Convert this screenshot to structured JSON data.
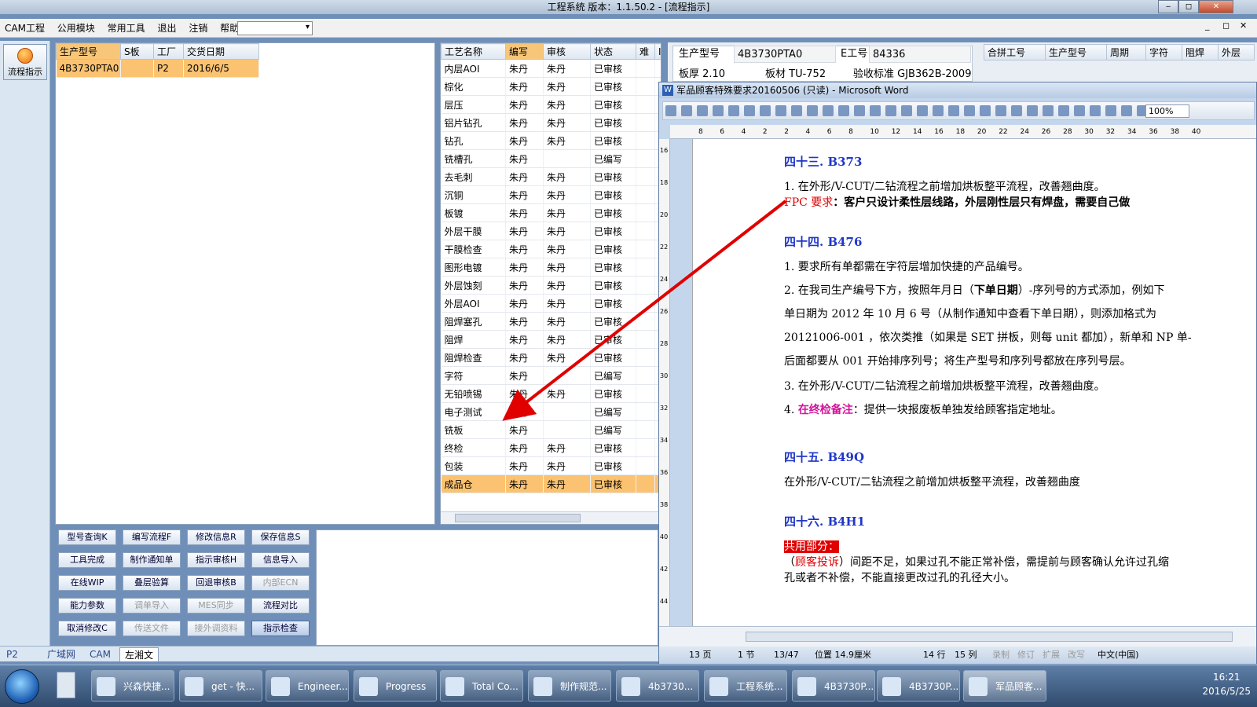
{
  "app": {
    "title": "工程系统   版本：1.1.50.2 - [流程指示]",
    "min": "‒",
    "max": "◻",
    "close": "✕"
  },
  "menu": {
    "items": [
      "CAM工程",
      "公用模块",
      "常用工具",
      "退出",
      "注销",
      "帮助"
    ],
    "help_arrow": "▸",
    "mdi_controls": [
      "_",
      "◻",
      "✕"
    ]
  },
  "left_panel": {
    "flow_button": "流程指示"
  },
  "model_table": {
    "headers": [
      "生产型号",
      "S板",
      "工厂",
      "交货日期"
    ],
    "rows": [
      [
        "4B3730PTA0",
        "",
        "P2",
        "2016/6/5"
      ]
    ]
  },
  "process_table": {
    "headers": [
      "工艺名称",
      "编写",
      "审核",
      "状态",
      "难",
      "I"
    ],
    "rows": [
      [
        "内层AOI",
        "朱丹",
        "朱丹",
        "已审核"
      ],
      [
        "棕化",
        "朱丹",
        "朱丹",
        "已审核"
      ],
      [
        "层压",
        "朱丹",
        "朱丹",
        "已审核"
      ],
      [
        "铝片钻孔",
        "朱丹",
        "朱丹",
        "已审核"
      ],
      [
        "钻孔",
        "朱丹",
        "朱丹",
        "已审核"
      ],
      [
        "铣槽孔",
        "朱丹",
        "",
        "已编写"
      ],
      [
        "去毛刺",
        "朱丹",
        "朱丹",
        "已审核"
      ],
      [
        "沉铜",
        "朱丹",
        "朱丹",
        "已审核"
      ],
      [
        "板镀",
        "朱丹",
        "朱丹",
        "已审核"
      ],
      [
        "外层干膜",
        "朱丹",
        "朱丹",
        "已审核"
      ],
      [
        "干膜检查",
        "朱丹",
        "朱丹",
        "已审核"
      ],
      [
        "图形电镀",
        "朱丹",
        "朱丹",
        "已审核"
      ],
      [
        "外层蚀刻",
        "朱丹",
        "朱丹",
        "已审核"
      ],
      [
        "外层AOI",
        "朱丹",
        "朱丹",
        "已审核"
      ],
      [
        "阻焊塞孔",
        "朱丹",
        "朱丹",
        "已审核"
      ],
      [
        "阻焊",
        "朱丹",
        "朱丹",
        "已审核"
      ],
      [
        "阻焊检查",
        "朱丹",
        "朱丹",
        "已审核"
      ],
      [
        "字符",
        "朱丹",
        "",
        "已编写"
      ],
      [
        "无铅喷锡",
        "朱丹",
        "朱丹",
        "已审核"
      ],
      [
        "电子测试",
        "朱丹",
        "",
        "已编写"
      ],
      [
        "铣板",
        "朱丹",
        "",
        "已编写"
      ],
      [
        "终检",
        "朱丹",
        "朱丹",
        "已审核"
      ],
      [
        "包装",
        "朱丹",
        "朱丹",
        "已审核"
      ],
      [
        "成品仓",
        "朱丹",
        "朱丹",
        "已审核"
      ]
    ],
    "selected_index": 23
  },
  "buttons": [
    [
      "型号查询K",
      "编写流程F",
      "修改信息R",
      "保存信息S"
    ],
    [
      "工具完成",
      "制作通知单",
      "指示审核H",
      "信息导入"
    ],
    [
      "在线WIP",
      "叠层验算",
      "回退审核B",
      "内部ECN"
    ],
    [
      "能力参数",
      "调单导入",
      "MES同步",
      "流程对比"
    ],
    [
      "取消修改C",
      "传送文件",
      "接外调资料",
      "指示检查"
    ]
  ],
  "info": {
    "model_label": "生产型号",
    "model_value": "4B3730PTA0",
    "e_label": "E工号",
    "e_value": "84336",
    "row2_a": "板厚  2.10",
    "row2_b": "板材  TU-752",
    "row2_c": "验收标准  GJB362B-2009"
  },
  "merge_table": {
    "headers": [
      "合拼工号",
      "生产型号",
      "周期",
      "字符",
      "阻焊",
      "外层"
    ]
  },
  "word": {
    "title": "军品顾客特殊要求20160506 (只读) - Microsoft Word",
    "zoom": "100%",
    "ruler": [
      "8",
      "6",
      "4",
      "2",
      "2",
      "4",
      "6",
      "8",
      "10",
      "12",
      "14",
      "16",
      "18",
      "20",
      "22",
      "24",
      "26",
      "28",
      "30",
      "32",
      "34",
      "36",
      "38",
      "40"
    ],
    "vruler": [
      "16",
      "18",
      "20",
      "22",
      "24",
      "26",
      "28",
      "30",
      "32",
      "34",
      "36",
      "38",
      "40",
      "42",
      "44"
    ],
    "h43": "四十三.   B373",
    "h43_1": "1.  在外形/V-CUT/二钻流程之前增加烘板整平流程，改善翘曲度。",
    "fpc_label": "FPC 要求",
    "fpc_text": "：客户只设计柔性层线路，外层刚性层只有焊盘，需要自己做",
    "h44": "四十四. B476",
    "p44_1": "1.  要求所有单都需在字符层增加快捷的产品编号。",
    "p44_2a": "2.  在我司生产编号下方，按照年月日（",
    "p44_2b": "下单日期",
    "p44_2c": "）-序列号的方式添加，例如下",
    "p44_2d": "单日期为  2012  年  10  月  6  号（从制作通知中查看下单日期），则添加格式为",
    "p44_2e": "20121006-001 ，依次类推（如果是 SET 拼板，则每 unit 都加），新单和 NP 单-",
    "p44_2f": "后面都要从 001 开始排序列号；将生产型号和序列号都放在序列号层。",
    "p44_3": "3.  在外形/V-CUT/二钻流程之前增加烘板整平流程，改善翘曲度。",
    "p44_4a": "4.  ",
    "p44_4b": "在终检备注",
    "p44_4c": "：提供一块报废板单独发给顾客指定地址。",
    "h45": "四十五. B49Q",
    "p45": "在外形/V-CUT/二钻流程之前增加烘板整平流程，改善翘曲度",
    "h46": "四十六. B4H1",
    "p46_label": "共用部分：",
    "p46_a": "（",
    "p46_b": "顾客投诉",
    "p46_c": "）间距不足，如果过孔不能正常补偿，需提前与顾客确认允许过孔缩",
    "p46_d": "孔或者不补偿，不能直接更改过孔的孔径大小。",
    "status": {
      "page": "13 页",
      "section": "1 节",
      "pages": "13/47",
      "pos": "位置 14.9厘米",
      "line": "14 行",
      "col": "15 列",
      "rec": "录制",
      "trk": "修订",
      "ext": "扩展",
      "ovr": "改写",
      "lang": "中文(中国)"
    }
  },
  "bottom_tabs": [
    "P2",
    "广域网",
    "CAM",
    "左湘文"
  ],
  "taskbar": {
    "items": [
      "兴森快捷...",
      "get - 快...",
      "Engineer...",
      "Progress",
      "Total Co...",
      "制作规范...",
      "4b3730...",
      "工程系统...",
      "4B3730P...",
      "4B3730P...",
      "军品顾客..."
    ],
    "time": "16:21",
    "date": "2016/5/25"
  },
  "colors": {
    "selected_row": "#fbc371",
    "heading": "#1f37c8",
    "accent_red": "#e00000",
    "annotation_arrow": "#e00000"
  }
}
